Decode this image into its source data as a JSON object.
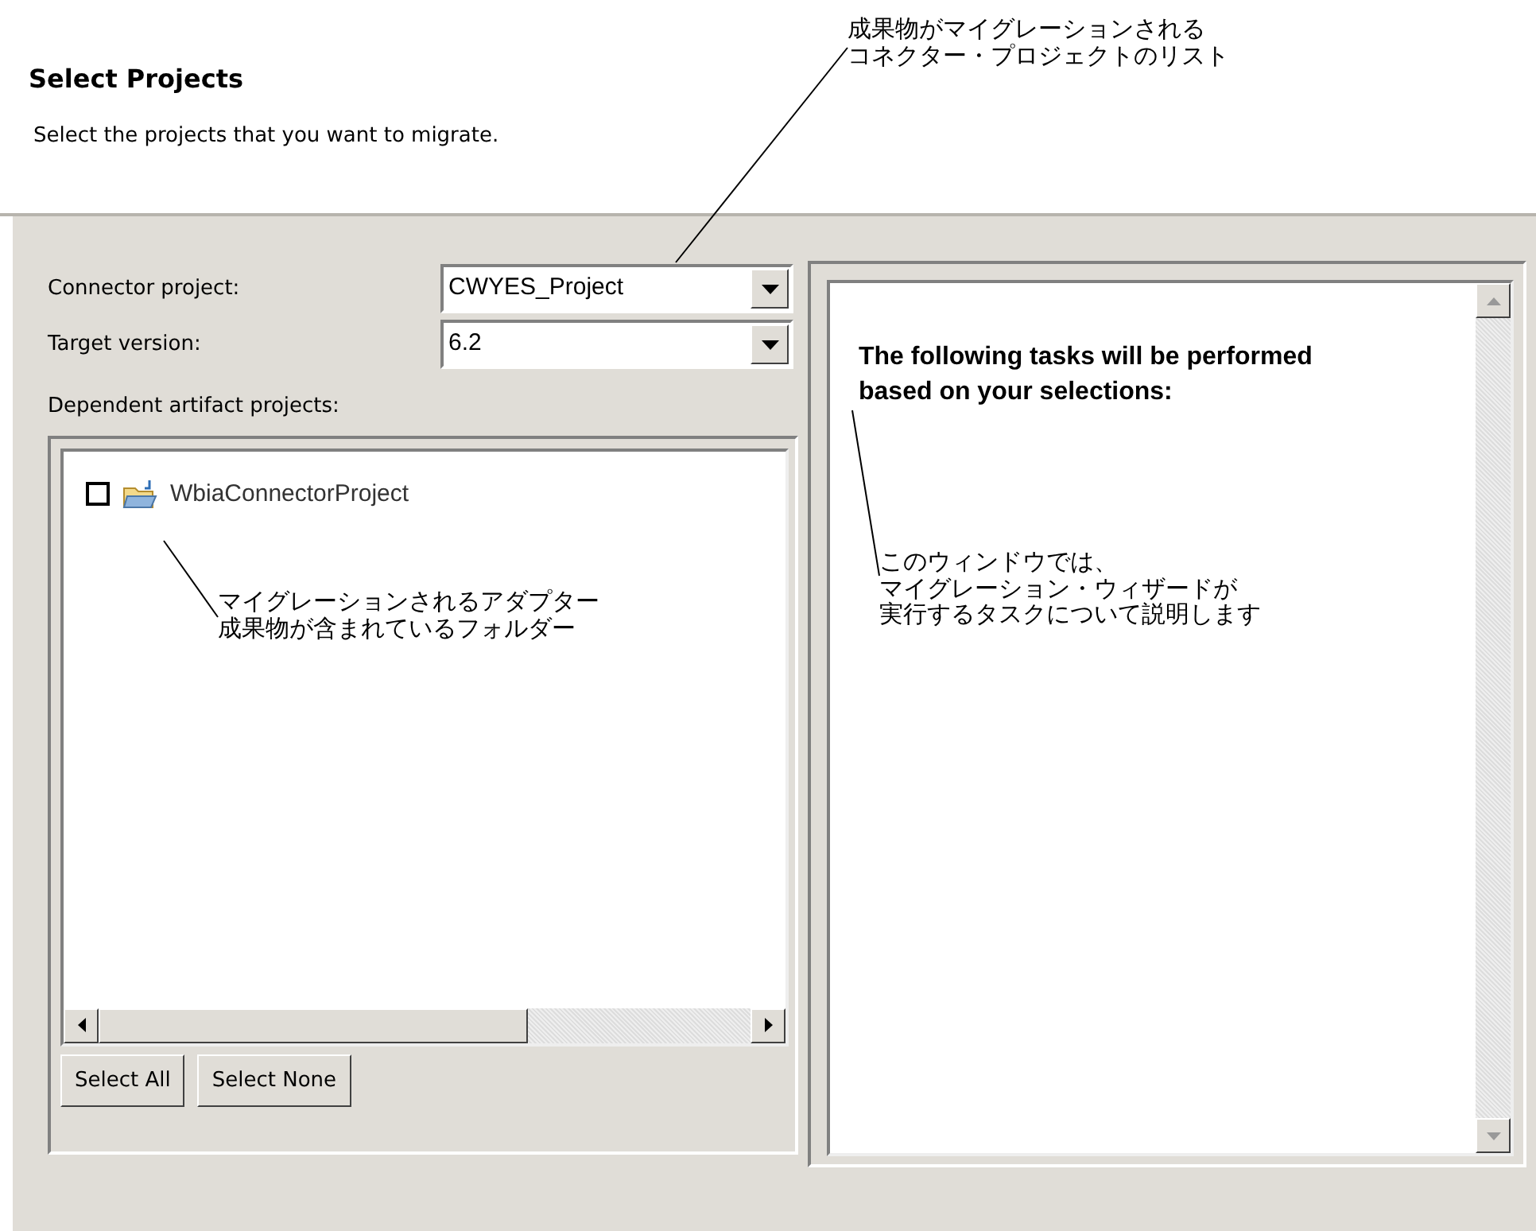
{
  "header": {
    "title": "Select Projects",
    "description": "Select the projects that you want to migrate."
  },
  "form": {
    "connector_project": {
      "label": "Connector project:",
      "value": "CWYES_Project"
    },
    "target_version": {
      "label": "Target version:",
      "value": "6.2"
    },
    "dependent_label": "Dependent artifact projects:",
    "projects": [
      {
        "name": "WbiaConnectorProject",
        "checked": false
      }
    ],
    "buttons": [
      "Select All",
      "Select None"
    ]
  },
  "tasks_panel": {
    "text": "The following tasks will be performed based on your selections:"
  },
  "callouts": [
    {
      "lines": [
        "成果物がマイグレーションされる",
        "コネクター・プロジェクトのリスト"
      ]
    },
    {
      "lines": [
        "マイグレーションされるアダプター",
        "成果物が含まれているフォルダー"
      ]
    },
    {
      "lines": [
        "このウィンドウでは、",
        "マイグレーション・ウィザードが",
        "実行するタスクについて説明します"
      ]
    }
  ]
}
